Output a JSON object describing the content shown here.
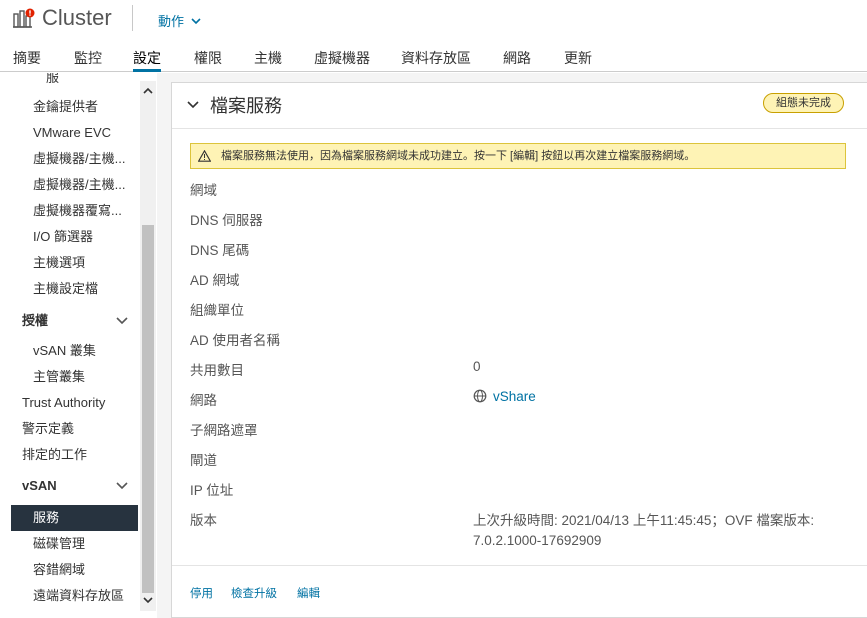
{
  "header": {
    "title": "Cluster",
    "actions_label": "動作"
  },
  "tabs": [
    {
      "label": "摘要"
    },
    {
      "label": "監控"
    },
    {
      "label": "設定"
    },
    {
      "label": "權限"
    },
    {
      "label": "主機"
    },
    {
      "label": "虛擬機器"
    },
    {
      "label": "資料存放區"
    },
    {
      "label": "網路"
    },
    {
      "label": "更新"
    }
  ],
  "sidebar": {
    "items": [
      {
        "label": "服",
        "type": "sub"
      },
      {
        "label": "金鑰提供者",
        "type": "sub"
      },
      {
        "label": "VMware EVC",
        "type": "sub"
      },
      {
        "label": "虛擬機器/主機...",
        "type": "sub"
      },
      {
        "label": "虛擬機器/主機...",
        "type": "sub"
      },
      {
        "label": "虛擬機器覆寫...",
        "type": "sub"
      },
      {
        "label": "I/O 篩選器",
        "type": "sub"
      },
      {
        "label": "主機選項",
        "type": "sub"
      },
      {
        "label": "主機設定檔",
        "type": "sub"
      },
      {
        "label": "授權",
        "type": "section"
      },
      {
        "label": "vSAN 叢集",
        "type": "sub"
      },
      {
        "label": "主管叢集",
        "type": "sub"
      },
      {
        "label": "Trust Authority",
        "type": "top"
      },
      {
        "label": "警示定義",
        "type": "top"
      },
      {
        "label": "排定的工作",
        "type": "top"
      },
      {
        "label": "vSAN",
        "type": "section"
      },
      {
        "label": "服務",
        "type": "selected"
      },
      {
        "label": "磁碟管理",
        "type": "sub"
      },
      {
        "label": "容錯網域",
        "type": "sub"
      },
      {
        "label": "遠端資料存放區",
        "type": "sub"
      }
    ]
  },
  "card": {
    "title": "檔案服務",
    "badge": "組態未完成",
    "alert": "檔案服務無法使用，因為檔案服務網域未成功建立。按一下 [編輯] 按鈕以再次建立檔案服務網域。",
    "properties": [
      {
        "label": "網域",
        "value": ""
      },
      {
        "label": "DNS 伺服器",
        "value": ""
      },
      {
        "label": "DNS 尾碼",
        "value": ""
      },
      {
        "label": "AD 網域",
        "value": ""
      },
      {
        "label": "組織單位",
        "value": ""
      },
      {
        "label": "AD 使用者名稱",
        "value": ""
      },
      {
        "label": "共用數目",
        "value": "0"
      },
      {
        "label": "網路",
        "value": "vShare"
      },
      {
        "label": "子網路遮罩",
        "value": ""
      },
      {
        "label": "閘道",
        "value": ""
      },
      {
        "label": "IP 位址",
        "value": ""
      },
      {
        "label": "版本",
        "value": "上次升級時間: 2021/04/13 上午11:45:45；OVF 檔案版本:",
        "value2": "7.0.2.1000-17692909"
      }
    ],
    "footer": {
      "disable": "停用",
      "check_upgrade": "檢查升級",
      "edit": "編輯"
    }
  },
  "colors": {
    "accent": "#0072a3",
    "selected_bg": "#27333f",
    "warning_bg": "#fef3b5"
  }
}
